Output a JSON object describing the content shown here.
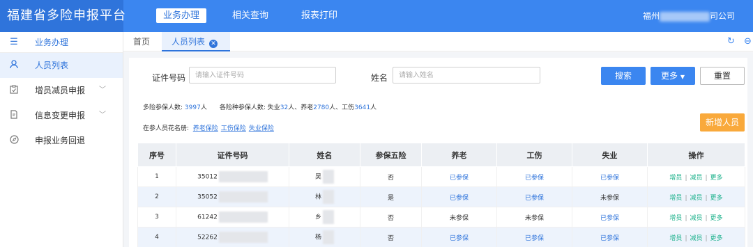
{
  "app": {
    "title": "福建省多险申报平台"
  },
  "topnav": {
    "items": [
      {
        "label": "业务办理",
        "active": true
      },
      {
        "label": "相关查询",
        "active": false
      },
      {
        "label": "报表打印",
        "active": false
      }
    ],
    "company_prefix": "福州",
    "company_suffix": "司公司"
  },
  "sidebar": {
    "items": [
      {
        "label": "业务办理",
        "icon": "list-icon"
      },
      {
        "label": "人员列表",
        "icon": "user-icon",
        "active": true
      },
      {
        "label": "增员减员申报",
        "icon": "clipboard-icon",
        "has_submenu": true
      },
      {
        "label": "信息变更申报",
        "icon": "edit-document-icon",
        "has_submenu": true
      },
      {
        "label": "申报业务回退",
        "icon": "compass-icon"
      }
    ]
  },
  "tabs": {
    "home": "首页",
    "current": "人员列表"
  },
  "search": {
    "id_label": "证件号码",
    "id_placeholder": "请输入证件号码",
    "name_label": "姓名",
    "name_placeholder": "请输入姓名",
    "search_button": "搜索",
    "more_button": "更多",
    "reset_button": "重置",
    "add_button": "新增人员"
  },
  "stats": {
    "multi_label": "多险参保人数:",
    "multi_count": "3997",
    "unit": "人",
    "per_label": "各险种参保人数: 失业",
    "unemployment_count": "32",
    "pension_label": "人、养老",
    "pension_count": "2780",
    "injury_label": "人、工伤",
    "injury_count": "3641",
    "end_unit": "人"
  },
  "roster": {
    "label": "在参人员花名册:",
    "links": [
      "养老保险",
      "工伤保险",
      "失业保险"
    ]
  },
  "table": {
    "headers": [
      "序号",
      "证件号码",
      "姓名",
      "参保五险",
      "养老",
      "工伤",
      "失业",
      "操作"
    ],
    "rows": [
      {
        "no": "1",
        "id": "35012",
        "name": "吴",
        "five": "否",
        "pension": "已参保",
        "injury": "已参保",
        "unemployment": "已参保"
      },
      {
        "no": "2",
        "id": "35052",
        "name": "林",
        "five": "是",
        "pension": "已参保",
        "injury": "已参保",
        "unemployment": "未参保"
      },
      {
        "no": "3",
        "id": "61242",
        "name": "乡",
        "five": "否",
        "pension": "未参保",
        "injury": "未参保",
        "unemployment": "已参保"
      },
      {
        "no": "4",
        "id": "52262",
        "name": "杨",
        "five": "否",
        "pension": "已参保",
        "injury": "已参保",
        "unemployment": "已参保"
      }
    ],
    "ops": {
      "add": "增员",
      "remove": "减员",
      "more": "更多",
      "sep": "|"
    }
  },
  "colors": {
    "primary": "#3b86f0",
    "brand_dark": "#2f74db",
    "accent_orange": "#f9a93b",
    "op_green": "#19b08a"
  }
}
